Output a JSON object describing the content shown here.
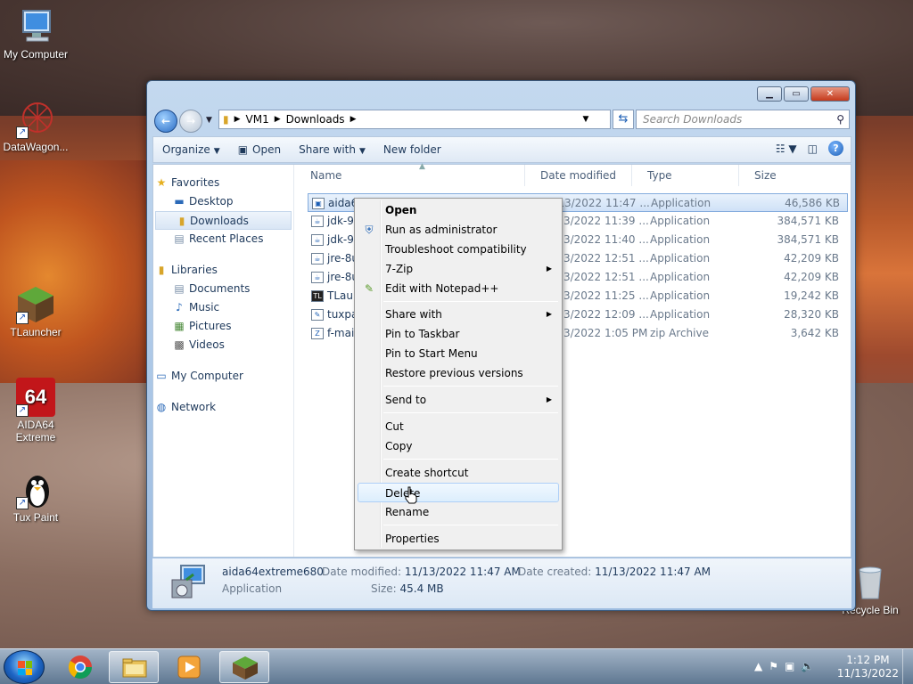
{
  "desktop": {
    "icons": [
      {
        "label": "My Computer"
      },
      {
        "label": "DataWagon..."
      },
      {
        "label": "TLauncher"
      },
      {
        "label": "AIDA64\nExtreme",
        "line1": "AIDA64",
        "line2": "Extreme"
      },
      {
        "label": "Tux Paint"
      },
      {
        "label": "Recycle Bin"
      }
    ]
  },
  "window": {
    "address": {
      "crumbs": [
        "VM1",
        "Downloads"
      ]
    },
    "search_placeholder": "Search Downloads",
    "toolbar": {
      "organize": "Organize",
      "open": "Open",
      "share_with": "Share with",
      "new_folder": "New folder"
    },
    "nav": {
      "favorites": "Favorites",
      "desktop": "Desktop",
      "downloads": "Downloads",
      "recent_places": "Recent Places",
      "libraries": "Libraries",
      "documents": "Documents",
      "music": "Music",
      "pictures": "Pictures",
      "videos": "Videos",
      "my_computer": "My Computer",
      "network": "Network"
    },
    "columns": {
      "name": "Name",
      "date": "Date modified",
      "type": "Type",
      "size": "Size"
    },
    "files": [
      {
        "name": "aida64extreme680",
        "date": "11/13/2022 11:47 ...",
        "type": "Application",
        "size": "46,586 KB"
      },
      {
        "name": "jdk-9",
        "date": "11/13/2022 11:39 ...",
        "type": "Application",
        "size": "384,571 KB"
      },
      {
        "name": "jdk-9",
        "date": "11/13/2022 11:40 ...",
        "type": "Application",
        "size": "384,571 KB"
      },
      {
        "name": "jre-8u",
        "date": "11/13/2022 12:51 ...",
        "type": "Application",
        "size": "42,209 KB"
      },
      {
        "name": "jre-8u",
        "date": "11/13/2022 12:51 ...",
        "type": "Application",
        "size": "42,209 KB"
      },
      {
        "name": "TLauncher",
        "date": "11/13/2022 11:25 ...",
        "type": "Application",
        "size": "19,242 KB"
      },
      {
        "name": "tuxpaint",
        "date": "11/13/2022 12:09 ...",
        "type": "Application",
        "size": "28,320 KB"
      },
      {
        "name": "f-main",
        "date": "11/13/2022 1:05 PM",
        "type": "zip Archive",
        "size": "3,642 KB"
      }
    ],
    "details": {
      "name": "aida64extreme680",
      "type": "Application",
      "modified_label": "Date modified:",
      "modified_value": "11/13/2022 11:47 AM",
      "created_label": "Date created:",
      "created_value": "11/13/2022 11:47 AM",
      "size_label": "Size:",
      "size_value": "45.4 MB"
    }
  },
  "context_menu": {
    "items": {
      "open": "Open",
      "run_admin": "Run as administrator",
      "troubleshoot": "Troubleshoot compatibility",
      "zip": "7-Zip",
      "notepad": "Edit with Notepad++",
      "share_with": "Share with",
      "pin_taskbar": "Pin to Taskbar",
      "pin_start": "Pin to Start Menu",
      "restore": "Restore previous versions",
      "send_to": "Send to",
      "cut": "Cut",
      "copy": "Copy",
      "create_shortcut": "Create shortcut",
      "delete": "Delete",
      "rename": "Rename",
      "properties": "Properties"
    }
  },
  "taskbar": {
    "clock_time": "1:12 PM",
    "clock_date": "11/13/2022"
  },
  "colors": {
    "accent": "#1d5fb5",
    "selection": "#cfe1f7"
  }
}
